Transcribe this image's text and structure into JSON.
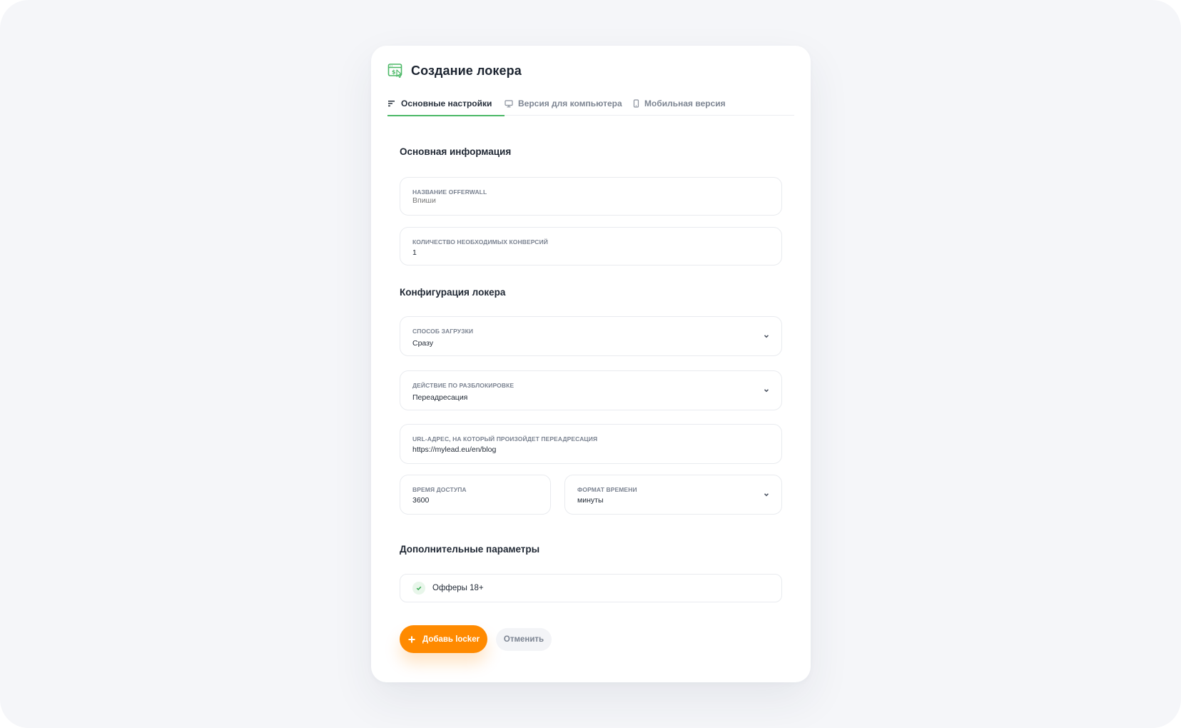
{
  "header": {
    "title": "Создание локера",
    "icon": "locker-dollar-icon",
    "accent_color": "#4bb866"
  },
  "tabs": [
    {
      "label": "Основные настройки",
      "icon": "sort-lines-icon",
      "active": true
    },
    {
      "label": "Версия для компьютера",
      "icon": "desktop-icon",
      "active": false
    },
    {
      "label": "Мобильная версия",
      "icon": "mobile-icon",
      "active": false
    }
  ],
  "sections": {
    "basic_info": "Основная информация",
    "config": "Конфигурация локера",
    "extra": "Дополнительные параметры"
  },
  "fields": {
    "offerwall_name": {
      "label": "Название offerwall",
      "placeholder": "Впиши",
      "value": ""
    },
    "conversions": {
      "label": "Количество необходимых конверсий",
      "value": "1"
    },
    "load_method": {
      "label": "Способ загрузки",
      "value": "Сразу"
    },
    "unlock_action": {
      "label": "Действие по разблокировке",
      "value": "Переадресация"
    },
    "redirect_url": {
      "label": "URL-адрес, на который произойдет переадресация",
      "value": "https://mylead.eu/en/blog"
    },
    "access_time": {
      "label": "Время доступа",
      "value": "3600"
    },
    "time_format": {
      "label": "Формат времени",
      "value": "минуты"
    }
  },
  "options": {
    "adult_offers": {
      "label": "Офферы 18+",
      "checked": true
    }
  },
  "buttons": {
    "submit": {
      "label": "Добавь locker",
      "color": "#ff8a00"
    },
    "cancel": {
      "label": "Отменить"
    }
  }
}
